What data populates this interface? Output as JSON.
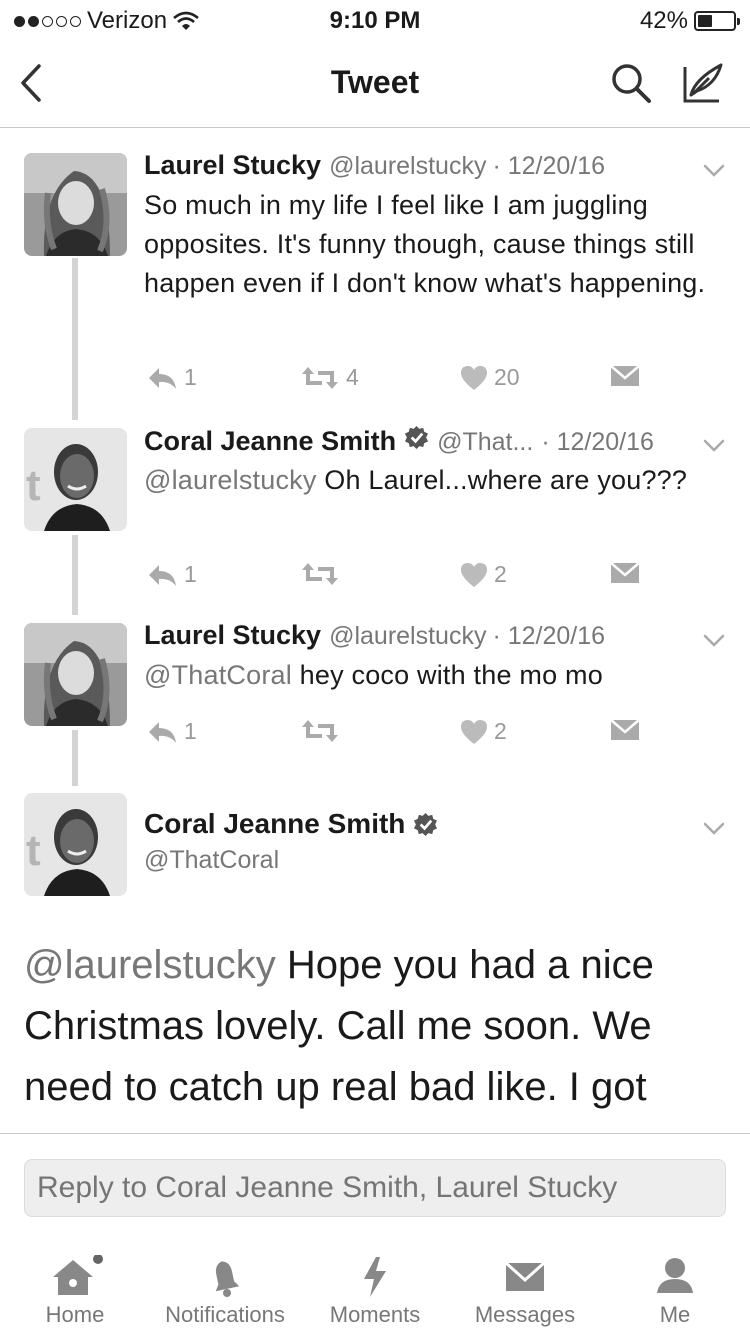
{
  "status_bar": {
    "carrier": "Verizon",
    "time": "9:10 PM",
    "battery_percent": "42%",
    "battery_level": 0.42,
    "signal_bars_filled": 2,
    "signal_bars_total": 5
  },
  "nav": {
    "title": "Tweet",
    "icons": [
      "back-chevron-icon",
      "search-icon",
      "compose-icon"
    ]
  },
  "tweets": [
    {
      "name": "Laurel Stucky",
      "handle": "@laurelstucky",
      "date": "· 12/20/16",
      "verified": false,
      "text": "So much in my life I feel like I am juggling opposites. It's funny though, cause things still happen even if I don't know what's happening.",
      "replies": "1",
      "retweets": "4",
      "likes": "20"
    },
    {
      "name": "Coral Jeanne Smith",
      "handle": "@That...",
      "date": "· 12/20/16",
      "verified": true,
      "mention": "@laurelstucky",
      "text": " Oh Laurel...where are you???",
      "replies": "1",
      "retweets": "",
      "likes": "2"
    },
    {
      "name": "Laurel Stucky",
      "handle": "@laurelstucky",
      "date": "· 12/20/16",
      "verified": false,
      "mention": "@ThatCoral",
      "text": " hey coco with the mo mo",
      "replies": "1",
      "retweets": "",
      "likes": "2"
    }
  ],
  "focused_tweet": {
    "name": "Coral Jeanne Smith",
    "handle": "@ThatCoral",
    "verified": true,
    "mention": "@laurelstucky",
    "text": " Hope you had a nice Christmas lovely. Call me soon. We need to catch up real bad like. I got"
  },
  "reply_bar": {
    "placeholder": "Reply to Coral Jeanne Smith, Laurel Stucky"
  },
  "tab_bar": {
    "tabs": [
      {
        "label": "Home",
        "icon": "home-icon"
      },
      {
        "label": "Notifications",
        "icon": "bell-icon"
      },
      {
        "label": "Moments",
        "icon": "lightning-icon"
      },
      {
        "label": "Messages",
        "icon": "envelope-icon"
      },
      {
        "label": "Me",
        "icon": "person-icon"
      }
    ]
  },
  "colors": {
    "text": "#1a1a1a",
    "secondary": "#777777",
    "icon_gray": "#999999",
    "divider": "#c9c9c9"
  }
}
